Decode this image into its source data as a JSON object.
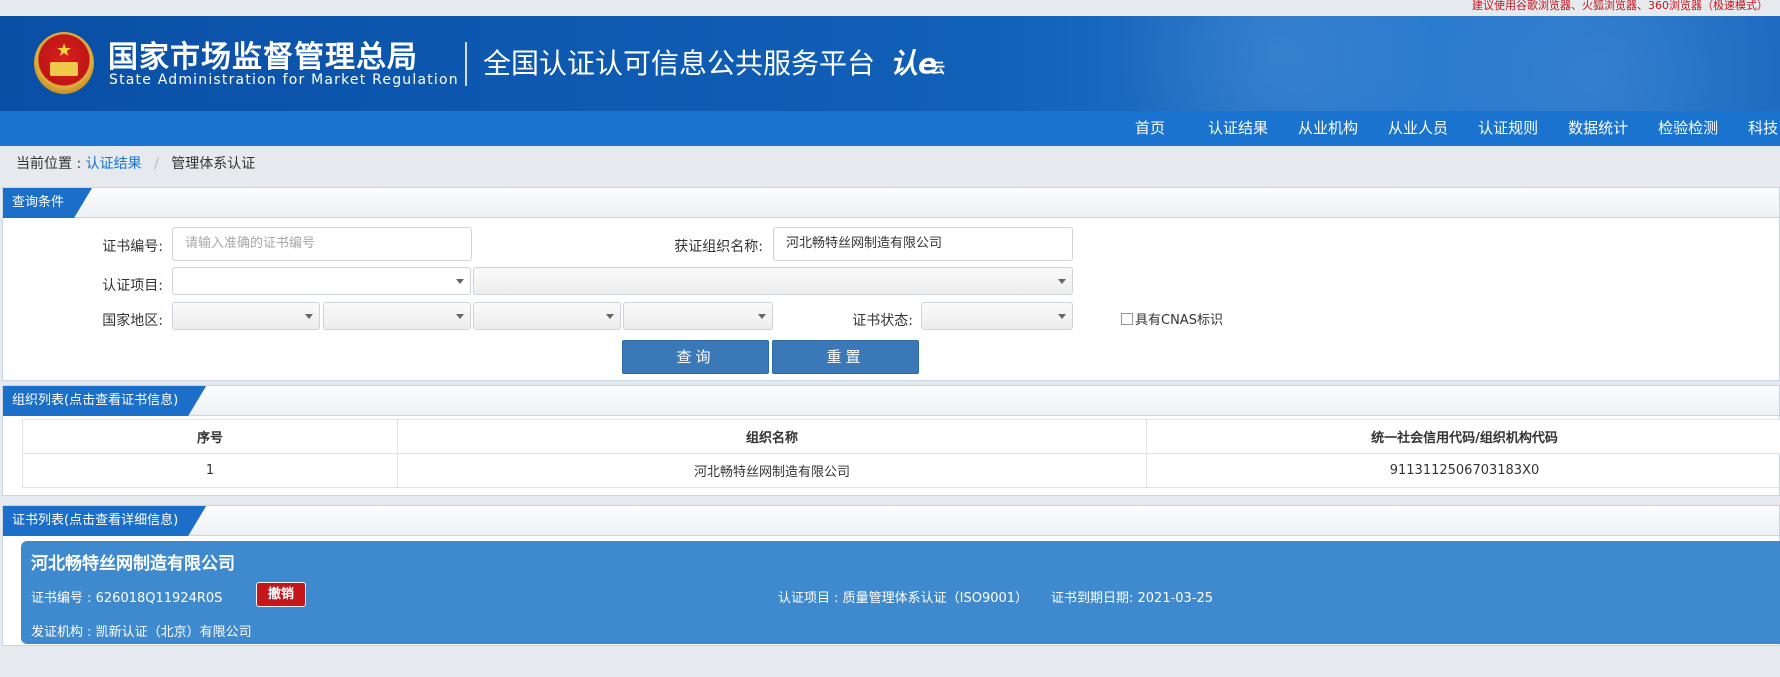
{
  "top_notice": "建议使用谷歌浏览器、火狐浏览器、360浏览器（极速模式）",
  "header": {
    "org_cn": "国家市场监督管理总局",
    "org_en": "State Administration  for  Market Regulation",
    "platform": "全国认证认可信息公共服务平台",
    "logo_text": "认e",
    "logo_sub": "云"
  },
  "nav": {
    "items": [
      "首页",
      "认证结果",
      "从业机构",
      "从业人员",
      "认证规则",
      "数据统计",
      "检验检测",
      "科技"
    ]
  },
  "breadcrumb": {
    "prefix": "当前位置 :",
    "link": "认证结果",
    "separator": "/",
    "current": "管理体系认证"
  },
  "query": {
    "title": "查询条件",
    "cert_no_label": "证书编号:",
    "cert_no_placeholder": "请输入准确的证书编号",
    "org_name_label": "获证组织名称:",
    "org_name_value": "河北畅特丝网制造有限公司",
    "project_label": "认证项目:",
    "region_label": "国家地区:",
    "status_label": "证书状态:",
    "cnas_label": "具有CNAS标识",
    "search_button": "查询",
    "reset_button": "重置"
  },
  "org_list": {
    "title": "组织列表(点击查看证书信息)",
    "headers": [
      "序号",
      "组织名称",
      "统一社会信用代码/组织机构代码"
    ],
    "rows": [
      [
        "1",
        "河北畅特丝网制造有限公司",
        "9113112506703183X0"
      ]
    ]
  },
  "cert_list": {
    "title": "证书列表(点击查看详细信息)",
    "cards": [
      {
        "org_name": "河北畅特丝网制造有限公司",
        "cert_no": "证书编号 : 626018Q11924R0S",
        "status": "撤销",
        "project": "认证项目 : 质量管理体系认证（ISO9001）",
        "expiry": "证书到期日期: 2021-03-25",
        "issuer": "发证机构 : 凯新认证（北京）有限公司"
      }
    ]
  },
  "colors": {
    "brand_blue": "#1a73cf",
    "header_blue": "#0a4fa6",
    "card_blue": "#3f89cf",
    "revoked_red": "#c5171a",
    "notice_red": "#c4161c"
  }
}
